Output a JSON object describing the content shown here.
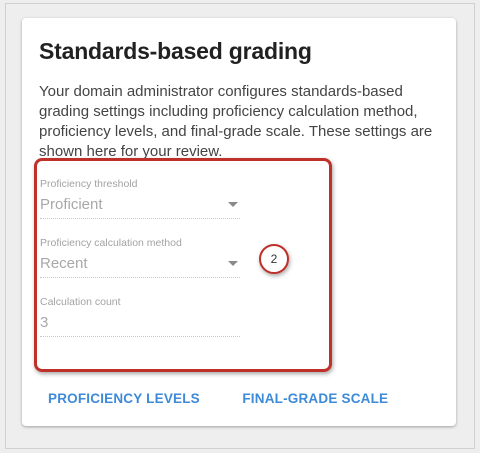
{
  "card": {
    "title": "Standards-based grading",
    "description": "Your domain administrator configures standards-based grading settings including proficiency calculation method, proficiency levels, and final-grade scale. These settings are shown here for your review."
  },
  "fields": [
    {
      "label": "Proficiency threshold",
      "value": "Proficient",
      "type": "select"
    },
    {
      "label": "Proficiency calculation method",
      "value": "Recent",
      "type": "select"
    },
    {
      "label": "Calculation count",
      "value": "3",
      "type": "input"
    }
  ],
  "annotation": {
    "step_number": "2",
    "color": "#c0302b"
  },
  "actions": {
    "proficiency_levels": "PROFICIENCY LEVELS",
    "final_grade_scale": "FINAL-GRADE SCALE"
  },
  "colors": {
    "accent": "#3d8ad8",
    "annotation": "#c0302b"
  }
}
